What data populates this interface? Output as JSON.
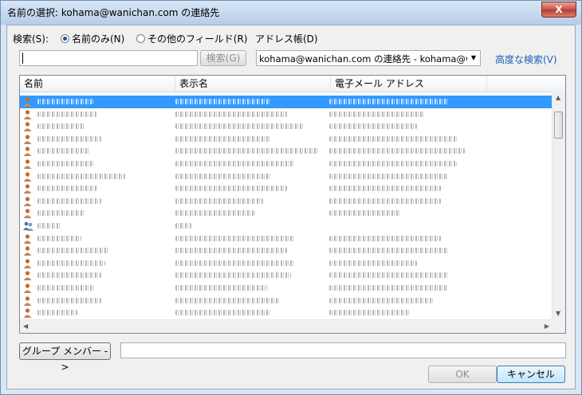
{
  "window": {
    "title": "名前の選択: kohama@wanichan.com の連絡先",
    "close": "X"
  },
  "search": {
    "label": "検索(S):",
    "radio_name_only": "名前のみ(N)",
    "radio_other_fields": "その他のフィールド(R)",
    "input_value": "",
    "button": "検索(G)"
  },
  "address_book": {
    "label": "アドレス帳(D)",
    "selected": "kohama@wanichan.com の連絡先 - kohama@wanic",
    "advanced_link": "高度な検索(V)"
  },
  "list": {
    "columns": [
      "名前",
      "表示名",
      "電子メール アドレス"
    ],
    "row_count": 18,
    "selected_index": 0,
    "group_index": 10
  },
  "footer": {
    "group_members_button": "グループ メンバー ->",
    "members_value": "",
    "ok": "OK",
    "cancel": "キャンセル"
  },
  "colors": {
    "selection": "#3399ff",
    "link": "#1a5fb4",
    "close": "#c75050"
  }
}
